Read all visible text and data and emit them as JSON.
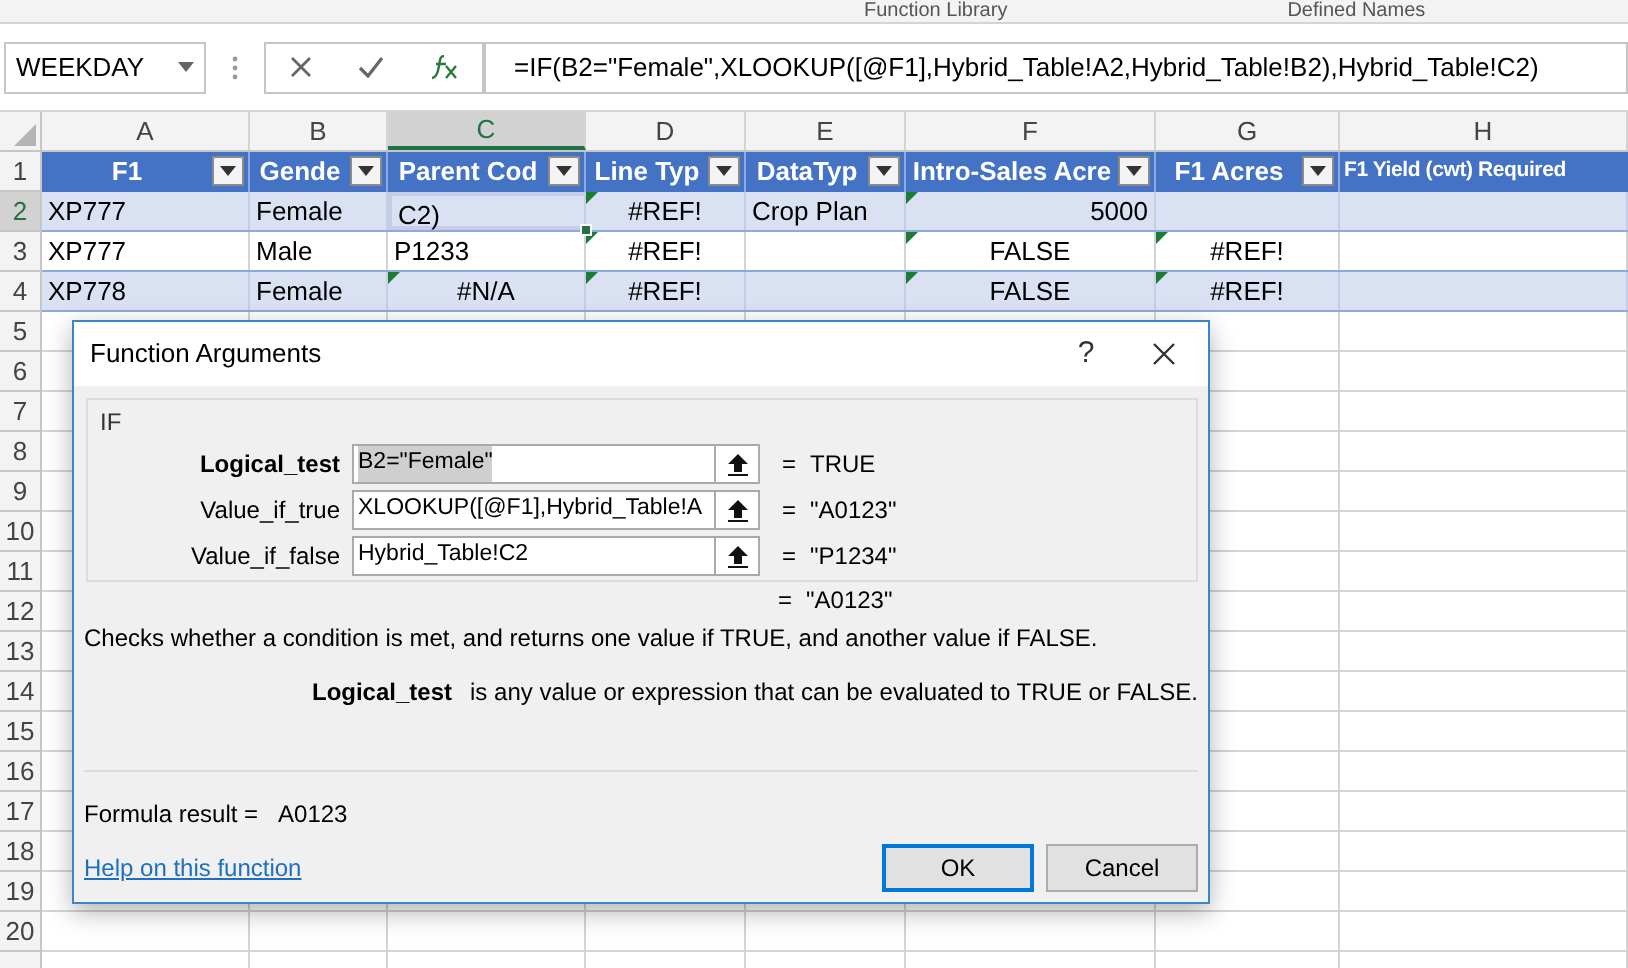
{
  "ribbon": {
    "groups": [
      "Function Library",
      "Defined Names"
    ]
  },
  "formula_bar": {
    "name_box": "WEEKDAY",
    "formula": "=IF(B2=\"Female\",XLOOKUP([@F1],Hybrid_Table!A2,Hybrid_Table!B2),Hybrid_Table!C2)"
  },
  "sheet": {
    "columns": [
      {
        "letter": "A",
        "selected": false
      },
      {
        "letter": "B",
        "selected": false
      },
      {
        "letter": "C",
        "selected": true
      },
      {
        "letter": "D",
        "selected": false
      },
      {
        "letter": "E",
        "selected": false
      },
      {
        "letter": "F",
        "selected": false
      },
      {
        "letter": "G",
        "selected": false
      },
      {
        "letter": "H",
        "selected": false
      }
    ],
    "header_row_number": "1",
    "table_headers": [
      "F1",
      "Gende",
      "Parent Cod",
      "Line Typ",
      "DataTyp",
      "Intro-Sales Acre",
      "F1 Acres",
      "F1 Yield (cwt) Required"
    ],
    "rows": [
      {
        "number": "2",
        "selected": true,
        "banded": true,
        "cells": [
          {
            "text": "XP777",
            "kind": "text",
            "flag": false
          },
          {
            "text": "Female",
            "kind": "text",
            "flag": false
          },
          {
            "text": "C2)",
            "kind": "editing",
            "flag": false
          },
          {
            "text": "#REF!",
            "kind": "error",
            "flag": true
          },
          {
            "text": "Crop Plan",
            "kind": "text",
            "flag": false
          },
          {
            "text": "5000",
            "kind": "number",
            "flag": true
          },
          {
            "kind": "empty",
            "flag": false
          },
          {
            "kind": "empty",
            "flag": false
          }
        ]
      },
      {
        "number": "3",
        "selected": false,
        "banded": false,
        "cells": [
          {
            "text": "XP777",
            "kind": "text",
            "flag": false
          },
          {
            "text": "Male",
            "kind": "text",
            "flag": false
          },
          {
            "text": "P1233",
            "kind": "text",
            "flag": false
          },
          {
            "text": "#REF!",
            "kind": "error",
            "flag": true
          },
          {
            "kind": "empty",
            "flag": false
          },
          {
            "text": "FALSE",
            "kind": "error",
            "flag": true
          },
          {
            "text": "#REF!",
            "kind": "error",
            "flag": true
          },
          {
            "kind": "empty",
            "flag": false
          }
        ]
      },
      {
        "number": "4",
        "selected": false,
        "banded": true,
        "cells": [
          {
            "text": "XP778",
            "kind": "text",
            "flag": false
          },
          {
            "text": "Female",
            "kind": "text",
            "flag": false
          },
          {
            "text": "#N/A",
            "kind": "error",
            "flag": true
          },
          {
            "text": "#REF!",
            "kind": "error",
            "flag": true
          },
          {
            "kind": "empty",
            "flag": false
          },
          {
            "text": "FALSE",
            "kind": "error",
            "flag": true
          },
          {
            "text": "#REF!",
            "kind": "error",
            "flag": true
          },
          {
            "kind": "empty",
            "flag": false
          }
        ]
      }
    ],
    "empty_rows": [
      "5",
      "6",
      "7",
      "8",
      "9",
      "10",
      "11",
      "12",
      "13",
      "14",
      "15",
      "16",
      "17",
      "18",
      "19",
      "20"
    ]
  },
  "dialog": {
    "title": "Function Arguments",
    "help": "?",
    "group": "IF",
    "arguments": [
      {
        "name": "Logical_test",
        "value": "B2=\"Female\"",
        "result": "TRUE",
        "selected": true
      },
      {
        "name": "Value_if_true",
        "value": "XLOOKUP([@F1],Hybrid_Table!A",
        "result": "\"A0123\"",
        "selected": false
      },
      {
        "name": "Value_if_false",
        "value": "Hybrid_Table!C2",
        "result": "\"P1234\"",
        "selected": false
      }
    ],
    "equals": "=",
    "overall_result": "\"A0123\"",
    "description": "Checks whether a condition is met, and returns one value if TRUE, and another value if FALSE.",
    "argument_name": "Logical_test",
    "argument_help": "is any value or expression that can be evaluated to TRUE or FALSE.",
    "formula_result_label": "Formula result =",
    "formula_result": "A0123",
    "help_link": "Help on this function",
    "buttons": [
      {
        "label": "OK",
        "kind": "default"
      },
      {
        "label": "Cancel",
        "kind": "normal"
      }
    ]
  }
}
